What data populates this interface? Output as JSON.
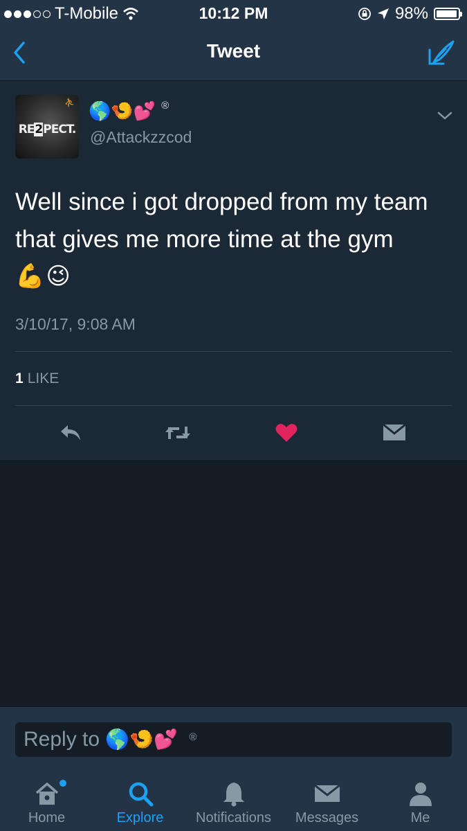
{
  "status_bar": {
    "carrier": "T-Mobile",
    "time": "10:12 PM",
    "battery": "98%",
    "battery_level": 0.98,
    "signal_bars_filled": 3,
    "signal_bars_total": 5
  },
  "nav": {
    "title": "Tweet",
    "back_icon": "chevron-left-icon",
    "compose_icon": "compose-tweet-icon"
  },
  "tweet": {
    "avatar_text_a": "RE",
    "avatar_text_num": "2",
    "avatar_text_b": "PECT.",
    "avatar_logo": "⛹",
    "display_name_emoji": "🌎🍤💕",
    "display_name_mark": "®",
    "handle": "@Attackzzcod",
    "text": "Well since i got dropped from my team that gives me more time at the gym",
    "text_emoji": "💪😉",
    "timestamp": "3/10/17, 9:08 AM",
    "like_count": "1",
    "like_label": "LIKE",
    "liked": true
  },
  "reply": {
    "placeholder_prefix": "Reply to",
    "placeholder_emoji": "🌎🍤💕",
    "placeholder_mark": "®"
  },
  "tabs": [
    {
      "label": "Home",
      "icon": "home-icon",
      "active": false,
      "has_dot": true
    },
    {
      "label": "Explore",
      "icon": "search-icon",
      "active": true
    },
    {
      "label": "Notifications",
      "icon": "bell-icon",
      "active": false
    },
    {
      "label": "Messages",
      "icon": "envelope-icon",
      "active": false
    },
    {
      "label": "Me",
      "icon": "person-icon",
      "active": false
    }
  ],
  "colors": {
    "accent": "#1da1f2",
    "like": "#e0245e",
    "muted": "#8899a6",
    "background": "#141d26",
    "card": "#1b2836",
    "bar": "#243447"
  }
}
